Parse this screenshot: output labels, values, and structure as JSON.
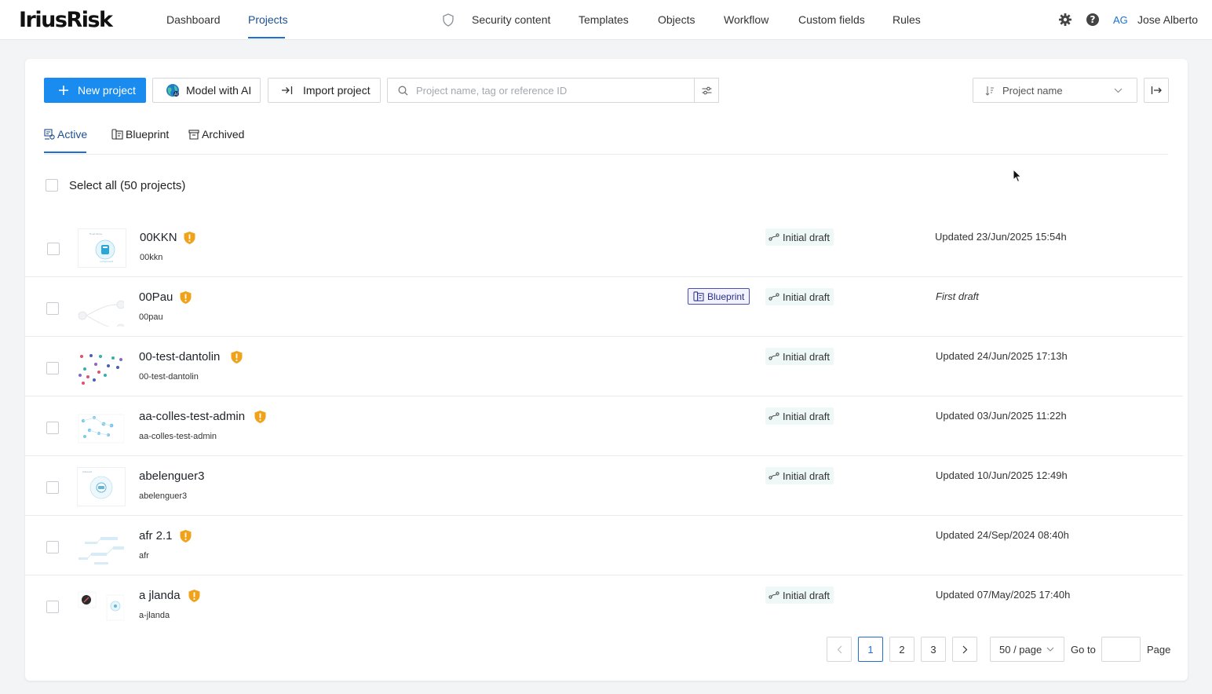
{
  "brand": {
    "logo": "IriusRisk"
  },
  "nav": {
    "dashboard": "Dashboard",
    "projects": "Projects",
    "security_content": "Security content",
    "templates": "Templates",
    "objects": "Objects",
    "workflow": "Workflow",
    "custom_fields": "Custom fields",
    "rules": "Rules"
  },
  "user": {
    "initials": "AG",
    "name": "Jose Alberto"
  },
  "toolbar": {
    "new_project": "New project",
    "model_with_ai": "Model with AI",
    "import_project": "Import project",
    "search_placeholder": "Project name, tag or reference ID",
    "sort_value": "Project name"
  },
  "tabs": {
    "active": "Active",
    "blueprint": "Blueprint",
    "archived": "Archived"
  },
  "select_all": "Select all (50 projects)",
  "colors": {
    "primary": "#1a8cf0",
    "warning": "#f0a31a",
    "blueprint": "#4a4fb0",
    "status_bg": "#eef8f6"
  },
  "projects": [
    {
      "name": "00KKN",
      "ref": "00kkn",
      "status": "Initial draft",
      "updated": "Updated 23/Jun/2025 15:54h"
    },
    {
      "name": "00Pau",
      "ref": "00pau",
      "badge": "Blueprint",
      "status": "Initial draft",
      "updated": "First draft"
    },
    {
      "name": "00-test-dantolin",
      "ref": "00-test-dantolin",
      "status": "Initial draft",
      "updated": "Updated 24/Jun/2025 17:13h"
    },
    {
      "name": "aa-colles-test-admin",
      "ref": "aa-colles-test-admin",
      "status": "Initial draft",
      "updated": "Updated 03/Jun/2025 11:22h"
    },
    {
      "name": "abelenguer3",
      "ref": "abelenguer3",
      "status": "Initial draft",
      "updated": "Updated 10/Jun/2025 12:49h"
    },
    {
      "name": "afr 2.1",
      "ref": "afr",
      "updated": "Updated 24/Sep/2024 08:40h"
    },
    {
      "name": "a jlanda",
      "ref": "a-jlanda",
      "status": "Initial draft",
      "updated": "Updated 07/May/2025 17:40h"
    }
  ],
  "pagination": {
    "pages": [
      "1",
      "2",
      "3"
    ],
    "current": "1",
    "page_size": "50 / page",
    "goto_label": "Go to",
    "page_label": "Page"
  }
}
